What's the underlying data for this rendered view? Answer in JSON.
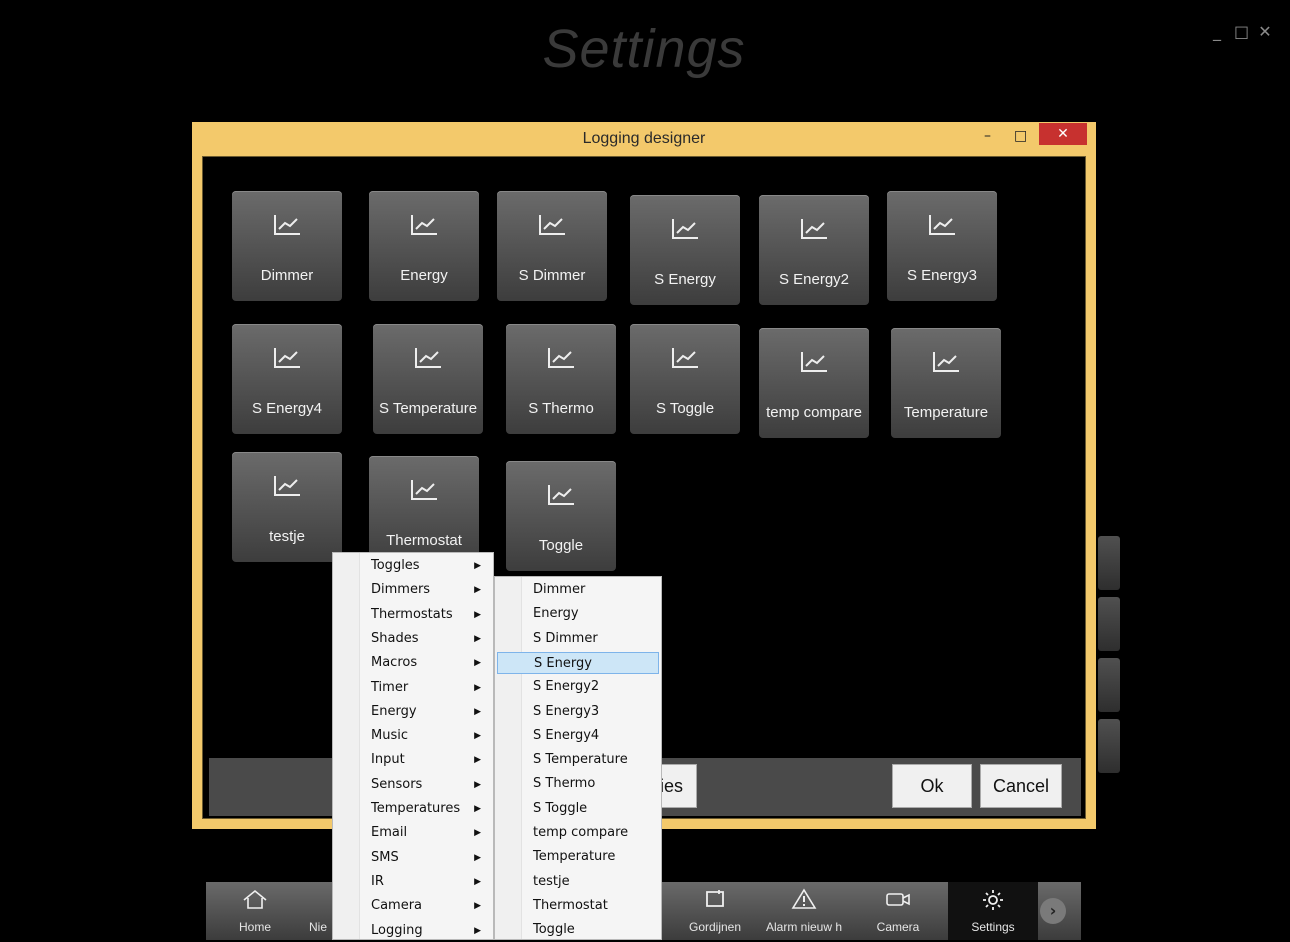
{
  "window": {
    "title": "Settings"
  },
  "window_controls": [
    "_",
    "□",
    "✕"
  ],
  "dialog": {
    "title": "Logging designer",
    "minimize": "–",
    "maximize": "□",
    "close": "✕"
  },
  "tiles": [
    "Dimmer",
    "Energy",
    "S Dimmer",
    "S Energy",
    "S Energy2",
    "S Energy3",
    "S Energy4",
    "S Temperature",
    "S Thermo",
    "S Toggle",
    "temp compare",
    "Temperature",
    "testje",
    "Thermostat",
    "Toggle"
  ],
  "buttons": {
    "partial": "ies",
    "ok": "Ok",
    "cancel": "Cancel"
  },
  "menu_primary": [
    "Toggles",
    "Dimmers",
    "Thermostats",
    "Shades",
    "Macros",
    "Timer",
    "Energy",
    "Music",
    "Input",
    "Sensors",
    "Temperatures",
    "Email",
    "SMS",
    "IR",
    "Camera",
    "Logging"
  ],
  "menu_secondary": [
    "Dimmer",
    "Energy",
    "S Dimmer",
    "S Energy",
    "S Energy2",
    "S Energy3",
    "S Energy4",
    "S Temperature",
    "S Thermo",
    "S Toggle",
    "temp compare",
    "Temperature",
    "testje",
    "Thermostat",
    "Toggle"
  ],
  "menu_selected": "S Energy",
  "taskbar": {
    "home": "Home",
    "nieuw": "Nie",
    "gordijnen": "Gordijnen",
    "alarm": "Alarm nieuw h",
    "camera": "Camera",
    "settings": "Settings"
  },
  "icons": {
    "tile": "chart-line-icon",
    "menu_arrow": "chevron-right-icon"
  }
}
